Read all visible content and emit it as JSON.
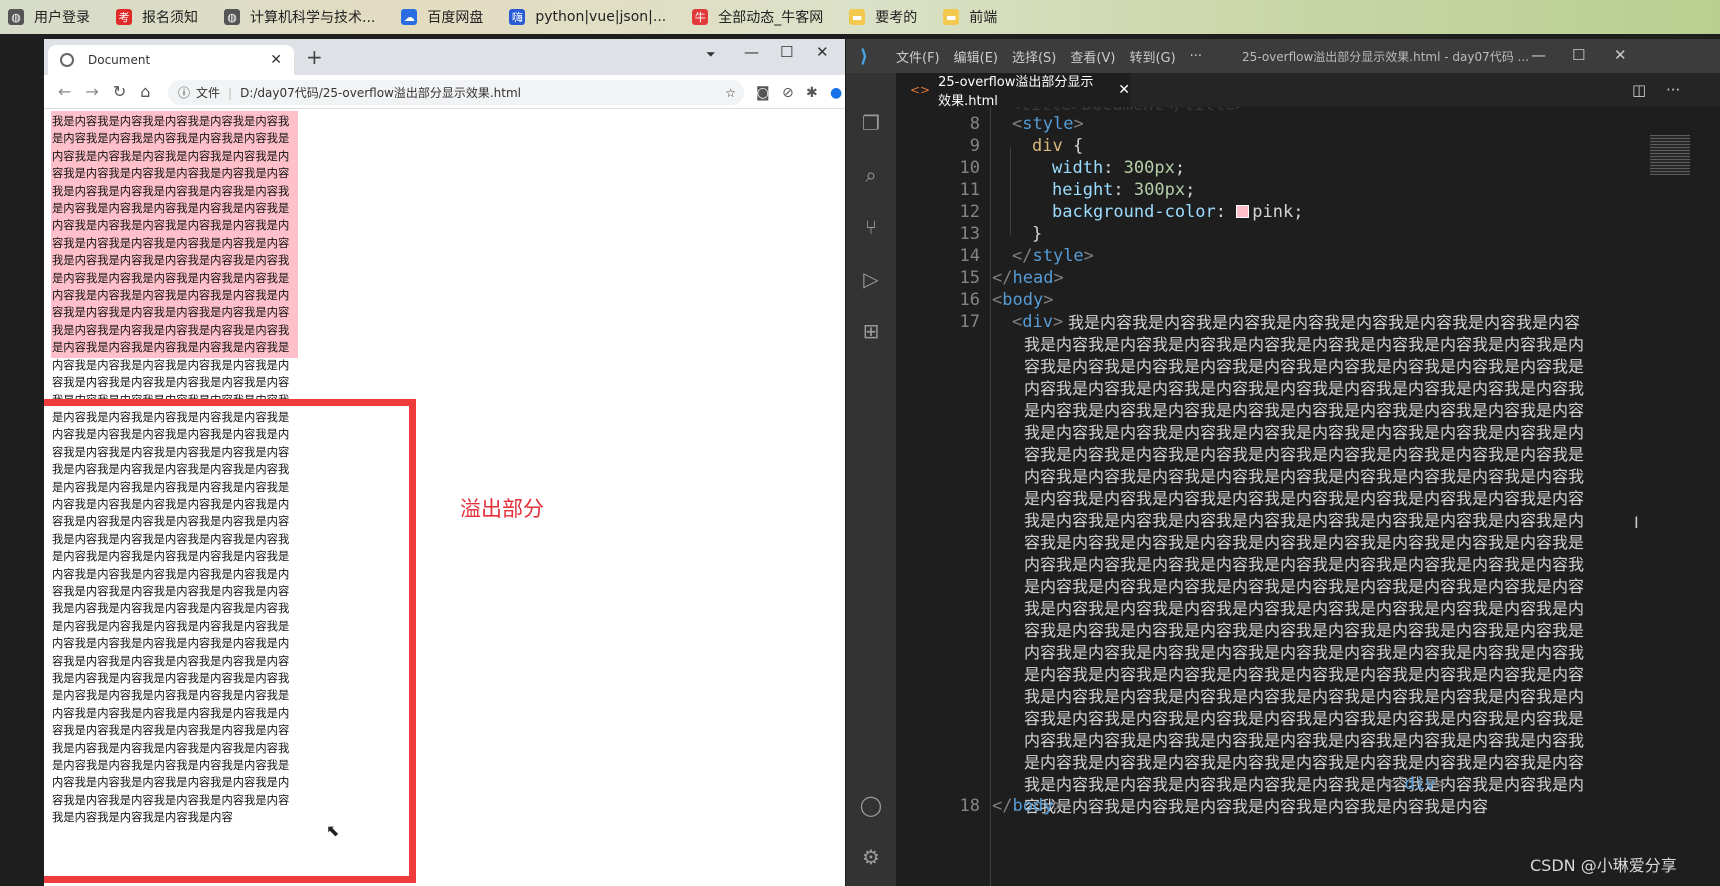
{
  "bookmarks": [
    {
      "label": "用户登录",
      "icon": "globe-icon",
      "color": "#555555"
    },
    {
      "label": "报名须知",
      "icon": "kao-icon",
      "color": "#e02a2a"
    },
    {
      "label": "计算机科学与技术...",
      "icon": "globe-icon",
      "color": "#555555"
    },
    {
      "label": "百度网盘",
      "icon": "baidu-cloud-icon",
      "color": "#2a6de0"
    },
    {
      "label": "python|vue|json|...",
      "icon": "hai-icon",
      "color": "#2a5bd7"
    },
    {
      "label": "全部动态_牛客网",
      "icon": "nowcoder-icon",
      "color": "#e03a3a"
    },
    {
      "label": "要考的",
      "icon": "folder-icon",
      "color": "#f2c94c"
    },
    {
      "label": "前端",
      "icon": "folder-icon",
      "color": "#f2c94c"
    }
  ],
  "browser": {
    "tab_title": "Document",
    "address_prefix": "文件",
    "address_path": "D:/day07代码/25-overflow溢出部分显示效果.html",
    "page_text": "我是内容我是内容我是内容我是内容我是内容我是内容我是内容我是内容我是内容我是内容我是内容我是内容我是内容我是内容我是内容我是内容我是内容我是内容我是内容我是内容我是内容我是内容我是内容我是内容我是内容我是内容我是内容我是内容我是内容我是内容我是内容我是内容我是内容我是内容我是内容我是内容我是内容我是内容我是内容我是内容我是内容我是内容我是内容我是内容我是内容我是内容我是内容我是内容我是内容我是内容我是内容我是内容我是内容我是内容我是内容我是内容我是内容我是内容我是内容我是内容我是内容我是内容我是内容我是内容我是内容我是内容我是内容我是内容我是内容我是内容我是内容我是内容我是内容我是内容我是内容我是内容我是内容我是内容我是内容我是内容我是内容我是内容我是内容我是内容我是内容我是内容我是内容我是内容我是内容我是内容我是内容我是内容我是内容我是内容我是内容我是内容我是内容我是内容我是内容我是内容我是内容我是内容我是内容我是内容我是内容我是内容我是内容我是内容我是内容我是内容我是内容我是内容我是内容我是内容我是内容我是内容我是内容我是内容我是内容我是内容我是内容我是内容我是内容我是内容我是内容我是内容我是内容我是内容我是内容我是内容我是内容我是内容我是内容我是内容我是内容我是内容我是内容我是内容我是内容我是内容我是内容我是内容我是内容我是内容我是内容我是内容我是内容我是内容我是内容我是内容我是内容我是内容我是内容我是内容我是内容我是内容我是内容我是内容我是内容我是内容我是内容我是内容我是内容我是内容我是内容我是内容我是内容我是内容我是内容我是内容我是内容我是内容我是内容我是内容我是内容我是内容我是内容我是内容我是内容我是内容我是内容我是内容我是内容我是内容我是内容我是内容我是内容我是内容我是内容我是内容我是内容我是内容我是内容我是内容我是内容我是内容我是内容我是内容我是内容我是内容我是内容我是内容我是内容我是内容我是内容我是内容我是内容我是内容我是内容我是内容我是内容我是内容我是内容我是内容",
    "overflow_annotation": "溢出部分",
    "pink_color": "#ffc0cb",
    "annotation_color": "#ef3b3b"
  },
  "vscode": {
    "menu": [
      "文件(F)",
      "编辑(E)",
      "选择(S)",
      "查看(V)",
      "转到(G)",
      "···"
    ],
    "window_title": "25-overflow溢出部分显示效果.html - day07代码 ...",
    "editor_tab": "25-overflow溢出部分显示效果.html",
    "line_numbers": [
      "8",
      "9",
      "10",
      "11",
      "12",
      "13",
      "14",
      "15",
      "16",
      "17",
      "18"
    ],
    "code": {
      "l7_partial": "<title>Document</title>",
      "style_open": "style",
      "selector": "div",
      "width_prop": "width",
      "width_val": "300px",
      "height_prop": "height",
      "height_val": "300px",
      "bg_prop": "background-color",
      "bg_val": "pink",
      "close_brace": "}",
      "style_close": "style",
      "head_close": "head",
      "body_open": "body",
      "div_open": "div",
      "div_close": "div",
      "body_close": "body"
    },
    "body_text": "我是内容我是内容我是内容我是内容我是内容我是内容我是内容我是内容我是内容我是内容我是内容我是内容我是内容我是内容我是内容我是内容我是内容我是内容我是内容我是内容我是内容我是内容我是内容我是内容我是内容我是内容我是内容我是内容我是内容我是内容我是内容我是内容我是内容我是内容我是内容我是内容我是内容我是内容我是内容我是内容我是内容我是内容我是内容我是内容我是内容我是内容我是内容我是内容我是内容我是内容我是内容我是内容我是内容我是内容我是内容我是内容我是内容我是内容我是内容我是内容我是内容我是内容我是内容我是内容我是内容我是内容我是内容我是内容我是内容我是内容我是内容我是内容我是内容我是内容我是内容我是内容我是内容我是内容我是内容我是内容我是内容我是内容我是内容我是内容我是内容我是内容我是内容我是内容我是内容我是内容我是内容我是内容我是内容我是内容我是内容我是内容我是内容我是内容我是内容我是内容我是内容我是内容我是内容我是内容我是内容我是内容我是内容我是内容我是内容我是内容我是内容我是内容我是内容我是内容我是内容我是内容我是内容我是内容我是内容我是内容我是内容我是内容我是内容我是内容我是内容我是内容我是内容我是内容我是内容我是内容我是内容我是内容我是内容我是内容我是内容我是内容我是内容我是内容我是内容我是内容我是内容我是内容我是内容我是内容我是内容我是内容我是内容我是内容我是内容我是内容我是内容我是内容我是内容我是内容我是内容我是内容我是内容我是内容我是内容我是内容我是内容我是内容我是内容我是内容我是内容我是内容我是内容我是内容我是内容我是内容我是内容我是内容我是内容我是内容我是内容我是内容我是内容我是内容我是内容我是内容我是内容我是内容我是内容我是内容我是内容我是内容我是内容我是内容我是内容我是内容我是内容我是内容我是内容我是内容我是内容我是内容我是内容我是内容我是内容"
  },
  "watermark": "CSDN @小琳爱分享"
}
